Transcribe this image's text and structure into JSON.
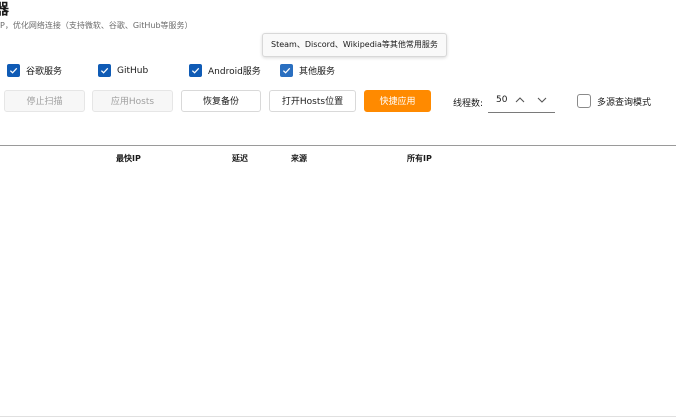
{
  "header": {
    "title": "器",
    "subtitle": "P，优化网络连接（支持微软、谷歌、GitHub等服务）"
  },
  "tooltip": "Steam、Discord、Wikipedia等其他常用服务",
  "services": [
    {
      "label": "谷歌服务",
      "checked": true
    },
    {
      "label": "GitHub",
      "checked": true
    },
    {
      "label": "Android服务",
      "checked": true
    },
    {
      "label": "其他服务",
      "checked": true
    }
  ],
  "buttons": {
    "stop_scan": "停止扫描",
    "apply_hosts": "应用Hosts",
    "restore_backup": "恢复备份",
    "open_hosts": "打开Hosts位置",
    "quick_apply": "快捷应用"
  },
  "threads": {
    "label": "线程数:",
    "value": "50"
  },
  "multi_source": {
    "label": "多源查询模式",
    "checked": false
  },
  "table": {
    "columns": [
      "最快IP",
      "延迟",
      "来源",
      "所有IP"
    ]
  },
  "colors": {
    "accent": "#0f5bb5",
    "primary_button": "#ff8a00"
  }
}
